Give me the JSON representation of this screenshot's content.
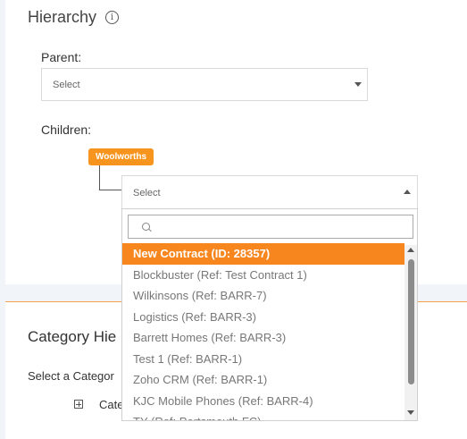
{
  "hierarchy": {
    "title": "Hierarchy",
    "info_icon": "info-icon",
    "parent_label": "Parent:",
    "parent_select_value": "Select",
    "children_label": "Children:",
    "child_tag": "Woolworths",
    "child_select_value": "Select"
  },
  "dropdown": {
    "search_value": "",
    "options": [
      "New Contract (ID: 28357)",
      "Blockbuster (Ref: Test Contract 1)",
      "Wilkinsons (Ref: BARR-7)",
      "Logistics (Ref: BARR-3)",
      "Barrett Homes (Ref: BARR-3)",
      "Test 1 (Ref: BARR-1)",
      "Zoho CRM (Ref: BARR-1)",
      "KJC Mobile Phones (Ref: BARR-4)",
      "TY (Ref: Portsmouth FC)"
    ],
    "active_index": 0
  },
  "category": {
    "title": "Category Hie",
    "select_label": "Select a Categor",
    "tree_item_label": "Cate"
  },
  "colors": {
    "accent": "#f7861e",
    "tag": "#f7941d",
    "background": "#f1f5fa"
  }
}
